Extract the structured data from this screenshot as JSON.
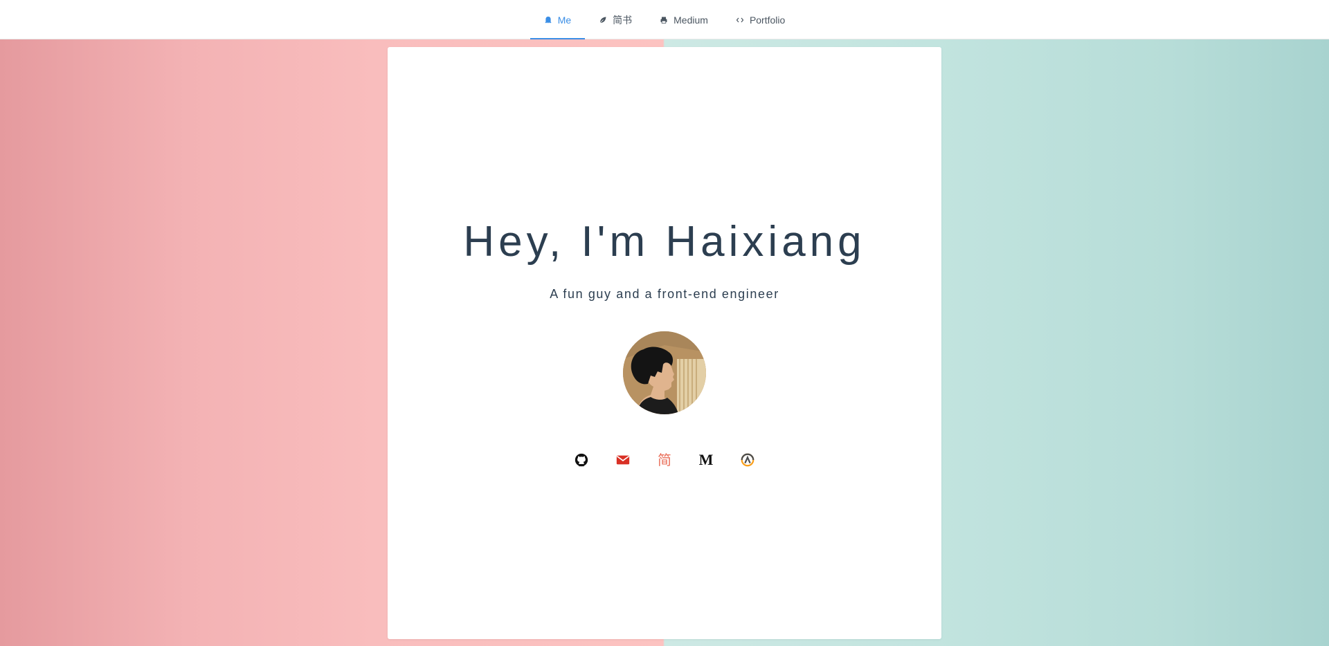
{
  "nav": {
    "tabs": [
      {
        "label": "Me",
        "icon": "ghost-icon",
        "active": true
      },
      {
        "label": "简书",
        "icon": "leaf-icon",
        "active": false
      },
      {
        "label": "Medium",
        "icon": "printer-icon",
        "active": false
      },
      {
        "label": "Portfolio",
        "icon": "code-icon",
        "active": false
      }
    ]
  },
  "hero": {
    "title": "Hey, I'm Haixiang",
    "subtitle": "A fun guy and a front-end engineer"
  },
  "social": [
    {
      "name": "github",
      "icon": "github-icon"
    },
    {
      "name": "email",
      "icon": "mail-icon",
      "color": "#d93025"
    },
    {
      "name": "jianshu",
      "text": "简",
      "icon": "jianshu-icon",
      "color": "#ea6f5a"
    },
    {
      "name": "medium",
      "text": "M",
      "icon": "medium-icon"
    },
    {
      "name": "overwatch",
      "icon": "overwatch-icon"
    }
  ],
  "colors": {
    "accent": "#3a8ee6",
    "text": "#2c3e50",
    "bg_left": "#f9bdbd",
    "bg_right": "#c2e4df"
  }
}
